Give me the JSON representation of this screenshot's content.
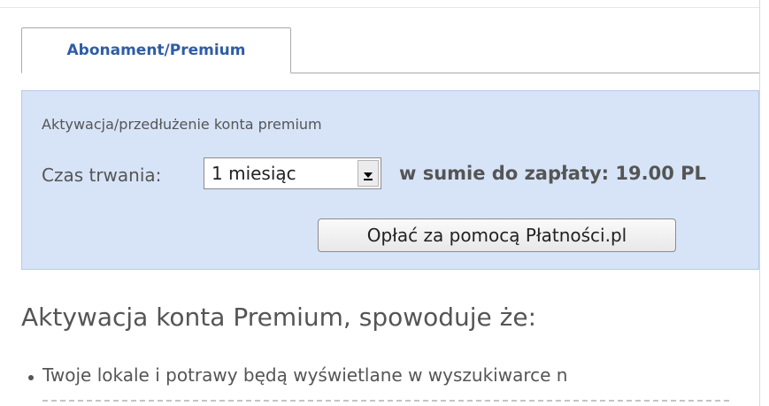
{
  "tabs": [
    {
      "label": "Abonament/Premium",
      "active": true
    }
  ],
  "premium_panel": {
    "title": "Aktywacja/przedłużenie konta premium",
    "duration_label": "Czas trwania:",
    "duration_select": {
      "selected": "1 miesiąc"
    },
    "total_text": "w sumie do zapłaty: 19.00 PL",
    "pay_button_label": "Opłać za pomocą Płatności.pl"
  },
  "benefits": {
    "heading": "Aktywacja konta Premium, spowoduje że:",
    "items": [
      "Twoje lokale i potrawy będą wyświetlane w wyszukiwarce n"
    ]
  },
  "colors": {
    "tab_text": "#2f5da6",
    "panel_bg": "#d7e4f7",
    "text": "#555555"
  }
}
